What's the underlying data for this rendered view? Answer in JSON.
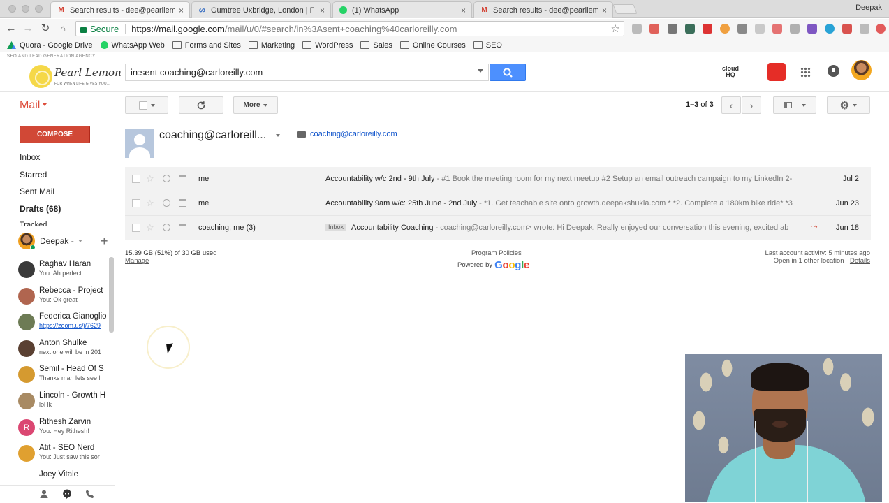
{
  "browser": {
    "profile": "Deepak",
    "tabs": [
      {
        "title": "Search results - dee@pearllem",
        "favicon": "gmail-icon"
      },
      {
        "title": "Gumtree Uxbridge, London | F",
        "favicon": "gumtree-icon"
      },
      {
        "title": "(1) WhatsApp",
        "favicon": "whatsapp-icon"
      },
      {
        "title": "Search results - dee@pearllem",
        "favicon": "gmail-icon"
      }
    ],
    "secure_label": "Secure",
    "url_host": "https://mail.google.com",
    "url_path": "/mail/u/0/#search/in%3Asent+coaching%40carloreilly.com",
    "bookmarks": [
      "Quora - Google Drive",
      "WhatsApp Web",
      "Forms and Sites",
      "Marketing",
      "WordPress",
      "Sales",
      "Online Courses",
      "SEO"
    ]
  },
  "header": {
    "agency_tagline": "SEO AND LEAD GENERATION AGENCY",
    "brand_name": "Pearl Lemon",
    "brand_sub": "FOR WHEN LIFE GIVES YOU...",
    "search_query": "in:sent coaching@carloreilly.com",
    "cloudhq_line1": "cloud",
    "cloudhq_line2": "HQ"
  },
  "toolbar": {
    "mail_label": "Mail",
    "more_label": "More",
    "count_range": "1–3",
    "count_of": "of",
    "count_total": "3"
  },
  "nav": {
    "compose_label": "COMPOSE",
    "items": [
      "Inbox",
      "Starred",
      "Sent Mail",
      "Drafts (68)",
      "Tracked"
    ]
  },
  "hangouts": {
    "me_name": "Deepak -",
    "contacts": [
      {
        "name": "Raghav Haran",
        "msg": "You: Ah perfect",
        "color": "#3a3a3a",
        "link": false
      },
      {
        "name": "Rebecca - Project",
        "msg": "You: Ok great",
        "color": "#b0654f",
        "link": false
      },
      {
        "name": "Federica Gianoglio",
        "msg": "https://zoom.us/j/7629",
        "color": "#6d7b55",
        "link": true
      },
      {
        "name": "Anton Shulke",
        "msg": "next one will be in 201",
        "color": "#5a4032",
        "link": false
      },
      {
        "name": "Semil - Head Of S",
        "msg": "Thanks man lets see l",
        "color": "#d59a30",
        "link": false
      },
      {
        "name": "Lincoln - Growth H",
        "msg": "lol lk",
        "color": "#a88a63",
        "link": false
      },
      {
        "name": "Rithesh Zarvin",
        "msg": "You: Hey Rithesh!",
        "color": "#db4772",
        "link": false,
        "initial": "R"
      },
      {
        "name": "Atit - SEO Nerd",
        "msg": "You: Just saw this sor",
        "color": "#e0a030",
        "link": false
      },
      {
        "name": "Joey Vitale",
        "msg": "",
        "color": "#ffffff",
        "link": false
      }
    ]
  },
  "conversation": {
    "contact_title": "coaching@carloreill...",
    "contact_email": "coaching@carloreilly.com"
  },
  "emails": [
    {
      "from": "me",
      "subject": "Accountability w/c 2nd - 9th July",
      "snippet": " - #1 Book the meeting room for my next meetup #2 Setup an email outreach campaign to my LinkedIn 2-",
      "label": "",
      "attachment": false,
      "date": "Jul 2"
    },
    {
      "from": "me",
      "subject": "Accountability 9am w/c: 25th June - 2nd July",
      "snippet": " - *1. Get teachable site onto growth.deepakshukla.com * *2. Complete a 180km bike ride* *3",
      "label": "",
      "attachment": false,
      "date": "Jun 23"
    },
    {
      "from": "coaching, me (3)",
      "subject": "Accountability Coaching",
      "snippet": " - coaching@carloreilly.com> wrote: Hi Deepak, Really enjoyed our conversation this evening, excited ab",
      "label": "Inbox",
      "attachment": true,
      "date": "Jun 18"
    }
  ],
  "footer": {
    "storage": "15.39 GB (51%) of 30 GB used",
    "manage": "Manage",
    "policies": "Program Policies",
    "powered_by": "Powered by",
    "google_logo": "Google",
    "activity_line1": "Last account activity: 5 minutes ago",
    "activity_line2": "Open in 1 other location",
    "details": "Details"
  },
  "colors": {
    "compose_red": "#d14836",
    "mail_red": "#dd4b39",
    "search_blue": "#4d90fe",
    "link_blue": "#1155cc"
  }
}
